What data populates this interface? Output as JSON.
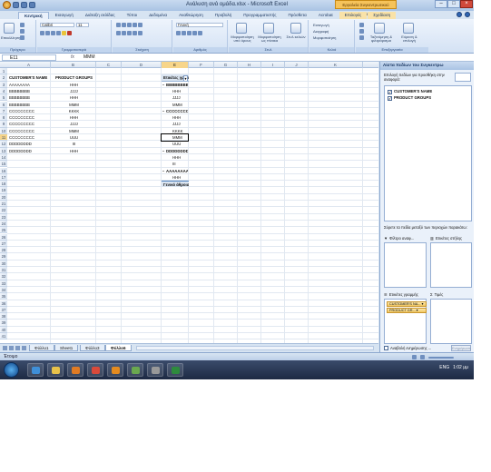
{
  "window": {
    "title": "Ανάλυση ανά ομάδα.xlsx - Microsoft Excel",
    "context_tab_group": "Εργαλεία Συγκεντρωτικού Πίνακα"
  },
  "ribbon_tabs": [
    "Κεντρική",
    "Εισαγωγή",
    "Διάταξη σελίδας",
    "Τύποι",
    "Δεδομένα",
    "Αναθεώρηση",
    "Προβολή",
    "Προγραμματιστής",
    "Πρόσθετα",
    "Acrobat",
    "Επιλογές",
    "Σχεδίαση"
  ],
  "ribbon": {
    "paste": "Επικόλληση",
    "font_name": "Calibri",
    "font_size": "11",
    "number_format": "Γενική",
    "cond_format": "Μορφοποίηση υπό όρους",
    "format_table": "Μορφοποίηση ως πίνακα",
    "cell_styles": "Στυλ κελιών",
    "insert": "Εισαγωγή",
    "delete": "Διαγραφή",
    "format": "Μορφοποίηση",
    "sort_filter": "Ταξινόμηση & φιλτράρισμα",
    "find_select": "Εύρεση & επιλογή",
    "group_labels": [
      "Πρόχειρο",
      "Γραμματοσειρά",
      "Στοίχιση",
      "Αριθμός",
      "Στυλ",
      "Κελιά",
      "Επεξεργασία"
    ]
  },
  "formula_bar": {
    "name_box": "E11",
    "fx": "fx",
    "value": "MMM"
  },
  "columns": [
    "A",
    "B",
    "C",
    "D",
    "E",
    "F",
    "G",
    "H",
    "I",
    "J",
    "K"
  ],
  "rows": [
    "1",
    "2",
    "3",
    "4",
    "5",
    "6",
    "7",
    "8",
    "9",
    "10",
    "11",
    "12",
    "13",
    "14",
    "15",
    "16",
    "17",
    "18",
    "19",
    "20",
    "21",
    "22",
    "23",
    "24",
    "25",
    "26",
    "27",
    "28",
    "29",
    "30",
    "31",
    "32",
    "33",
    "34",
    "35",
    "36",
    "37",
    "38",
    "39",
    "40",
    "41",
    "42"
  ],
  "table": {
    "headers": [
      "CUSTOMER'S NAME",
      "PRODUCT GROUPS"
    ],
    "data": [
      [
        "AAAAAAAA",
        "HHH"
      ],
      [
        "BBBBBBBB",
        "JJJJ"
      ],
      [
        "BBBBBBBB",
        "HHH"
      ],
      [
        "BBBBBBBB",
        "MMM"
      ],
      [
        "CCCCCCCCC",
        "KKKK"
      ],
      [
        "CCCCCCCCC",
        "HHH"
      ],
      [
        "CCCCCCCCC",
        "JJJJ"
      ],
      [
        "CCCCCCCCC",
        "MMM"
      ],
      [
        "CCCCCCCCC",
        "UUU"
      ],
      [
        "DDDDDDDD",
        "III"
      ],
      [
        "DDDDDDDD",
        "HHH"
      ]
    ]
  },
  "pivot": {
    "header": "Ετικέτες γραμμής",
    "items": [
      {
        "text": "BBBBBBBB",
        "level": 0
      },
      {
        "text": "HHH",
        "level": 1
      },
      {
        "text": "JJJJ",
        "level": 1
      },
      {
        "text": "MMM",
        "level": 1
      },
      {
        "text": "CCCCCCCCC",
        "level": 0
      },
      {
        "text": "HHH",
        "level": 1
      },
      {
        "text": "JJJJ",
        "level": 1
      },
      {
        "text": "KKKK",
        "level": 1
      },
      {
        "text": "MMM",
        "level": 1
      },
      {
        "text": "UUU",
        "level": 1
      },
      {
        "text": "DDDDDDDD",
        "level": 0
      },
      {
        "text": "HHH",
        "level": 1
      },
      {
        "text": "III",
        "level": 1
      },
      {
        "text": "AAAAAAAA",
        "level": 0
      },
      {
        "text": "HHH",
        "level": 1
      }
    ],
    "total": "Γενικό άθροισμα"
  },
  "sheet_tabs": [
    "Φύλλο1",
    "Sheet1",
    "Φύλλο3",
    "Φύλλο6"
  ],
  "active_sheet": "Φύλλο6",
  "pane": {
    "title": "Λίστα πεδίων του Συγκεντρω",
    "instruction": "Επιλογή πεδίων για προσθήκη στην αναφορά:",
    "fields": [
      "CUSTOMER'S NAME",
      "PRODUCT GROUPS"
    ],
    "drag_instruction": "Σύρετε τα πεδία μεταξύ των περιοχών παρακάτω:",
    "report_filter": "Φίλτρο αναφ...",
    "column_labels": "Ετικέτες στήλης",
    "row_labels": "Ετικέτες γραμμής",
    "values": "Τιμές",
    "row_chips": [
      "CUSTOMER'S NA... ▾",
      "PRODUCT GR... ▾"
    ],
    "defer": "Αναβολή ενημέρωσης ...",
    "update": "Ενημέρωση"
  },
  "status": {
    "ready": "Έτοιμο"
  },
  "tray": {
    "lang": "ENG",
    "time": "1:02 μμ"
  }
}
